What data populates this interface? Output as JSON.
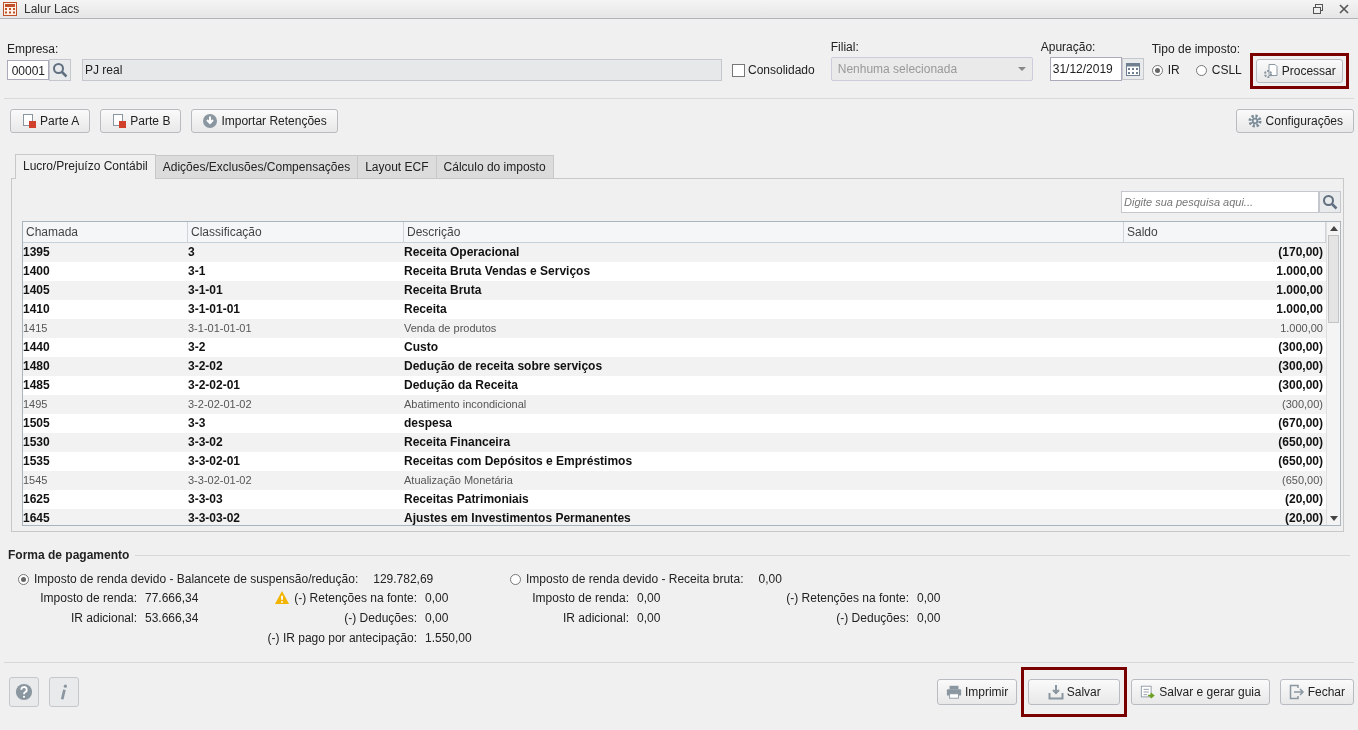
{
  "window": {
    "title": "Lalur Lacs"
  },
  "form": {
    "empresa_label": "Empresa:",
    "empresa_code": "00001",
    "empresa_name": "PJ real",
    "consolidado": {
      "label": "Consolidado",
      "checked": false
    },
    "filial_label": "Filial:",
    "filial": {
      "value": "Nenhuma selecionada",
      "disabled": true
    },
    "apuracao_label": "Apuração:",
    "apuracao": "31/12/2019",
    "tipo_label": "Tipo de imposto:",
    "tipos": [
      {
        "label": "IR",
        "selected": true
      },
      {
        "label": "CSLL",
        "selected": false
      }
    ],
    "processar": {
      "label": "Processar",
      "highlighted": true
    }
  },
  "toolbar": {
    "parte_a": "Parte A",
    "parte_b": "Parte B",
    "importar": "Importar Retenções",
    "configuracoes": "Configurações"
  },
  "tabs": [
    {
      "label": "Lucro/Prejuízo Contábil",
      "selected": true
    },
    {
      "label": "Adições/Exclusões/Compensações",
      "selected": false
    },
    {
      "label": "Layout ECF",
      "selected": false
    },
    {
      "label": "Cálculo do imposto",
      "selected": false
    }
  ],
  "search": {
    "placeholder": "Digite sua pesquisa aqui..."
  },
  "table": {
    "columns": [
      "Chamada",
      "Classificação",
      "Descrição",
      "Saldo"
    ],
    "rows": [
      {
        "cells": [
          "1395",
          "3",
          "Receita Operacional",
          "(170,00)"
        ],
        "kind": "group"
      },
      {
        "cells": [
          "1400",
          "3-1",
          "Receita Bruta Vendas e Serviços",
          "1.000,00"
        ],
        "kind": "group"
      },
      {
        "cells": [
          "1405",
          "3-1-01",
          "Receita Bruta",
          "1.000,00"
        ],
        "kind": "group"
      },
      {
        "cells": [
          "1410",
          "3-1-01-01",
          "Receita",
          "1.000,00"
        ],
        "kind": "group"
      },
      {
        "cells": [
          "1415",
          "3-1-01-01-01",
          "Venda de produtos",
          "1.000,00"
        ],
        "kind": "account"
      },
      {
        "cells": [
          "1440",
          "3-2",
          "Custo",
          "(300,00)"
        ],
        "kind": "group"
      },
      {
        "cells": [
          "1480",
          "3-2-02",
          "Dedução de receita sobre serviços",
          "(300,00)"
        ],
        "kind": "group"
      },
      {
        "cells": [
          "1485",
          "3-2-02-01",
          "Dedução da Receita",
          "(300,00)"
        ],
        "kind": "group"
      },
      {
        "cells": [
          "1495",
          "3-2-02-01-02",
          "Abatimento incondicional",
          "(300,00)"
        ],
        "kind": "account"
      },
      {
        "cells": [
          "1505",
          "3-3",
          "despesa",
          "(670,00)"
        ],
        "kind": "group"
      },
      {
        "cells": [
          "1530",
          "3-3-02",
          "Receita Financeira",
          "(650,00)"
        ],
        "kind": "group"
      },
      {
        "cells": [
          "1535",
          "3-3-02-01",
          "Receitas com Depósitos e Empréstimos",
          "(650,00)"
        ],
        "kind": "group"
      },
      {
        "cells": [
          "1545",
          "3-3-02-01-02",
          "Atualização Monetária",
          "(650,00)"
        ],
        "kind": "account"
      },
      {
        "cells": [
          "1625",
          "3-3-03",
          "Receitas Patrimoniais",
          "(20,00)"
        ],
        "kind": "group"
      },
      {
        "cells": [
          "1645",
          "3-3-03-02",
          "Ajustes em  Investimentos Permanentes",
          "(20,00)"
        ],
        "kind": "group"
      }
    ]
  },
  "payment": {
    "title": "Forma de pagamento",
    "options": [
      {
        "label": "Imposto de renda devido - Balancete de suspensão/redução:",
        "value": "129.782,69",
        "selected": true,
        "col1": [
          {
            "label": "Imposto de renda:",
            "value": "77.666,34",
            "warning": false
          },
          {
            "label": "IR adicional:",
            "value": "53.666,34",
            "warning": false
          }
        ],
        "col2": [
          {
            "label": "(-) Retenções na fonte:",
            "value": "0,00",
            "warning": true
          },
          {
            "label": "(-) Deduções:",
            "value": "0,00",
            "warning": false
          },
          {
            "label": "(-) IR pago por antecipação:",
            "value": "1.550,00",
            "warning": false
          }
        ]
      },
      {
        "label": "Imposto de renda devido - Receita bruta:",
        "value": "0,00",
        "selected": false,
        "col1": [
          {
            "label": "Imposto de renda:",
            "value": "0,00",
            "warning": false
          },
          {
            "label": "IR adicional:",
            "value": "0,00",
            "warning": false
          }
        ],
        "col2": [
          {
            "label": "(-) Retenções na fonte:",
            "value": "0,00",
            "warning": false
          },
          {
            "label": "(-) Deduções:",
            "value": "0,00",
            "warning": false
          }
        ]
      }
    ]
  },
  "footer": {
    "imprimir": "Imprimir",
    "salvar": {
      "label": "Salvar",
      "highlighted": true
    },
    "salvar_guia": "Salvar e gerar guia",
    "fechar": "Fechar"
  }
}
